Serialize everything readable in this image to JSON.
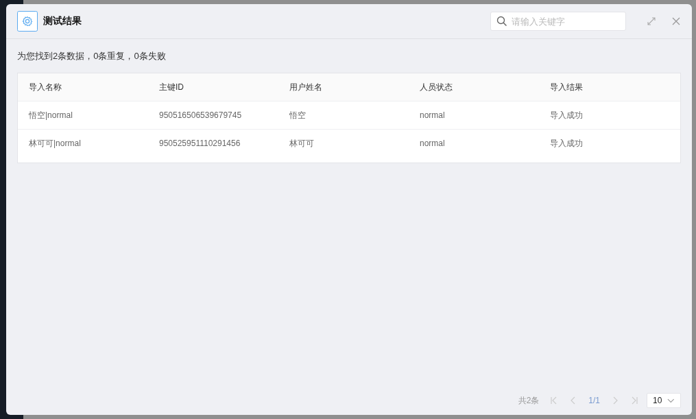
{
  "dialog": {
    "title": "测试结果",
    "search": {
      "placeholder": "请输入关键字"
    }
  },
  "summary": "为您找到2条数据，0条重复，0条失败",
  "table": {
    "columns": [
      "导入名称",
      "主键ID",
      "用户姓名",
      "人员状态",
      "导入结果"
    ],
    "rows": [
      [
        "悟空|normal",
        "950516506539679745",
        "悟空",
        "normal",
        "导入成功"
      ],
      [
        "林可可|normal",
        "950525951110291456",
        "林可可",
        "normal",
        "导入成功"
      ]
    ]
  },
  "pagination": {
    "total": "共2条",
    "page": "1/1",
    "page_size": "10",
    "first_disabled": true,
    "prev_disabled": true,
    "next_disabled": true,
    "last_disabled": true
  }
}
